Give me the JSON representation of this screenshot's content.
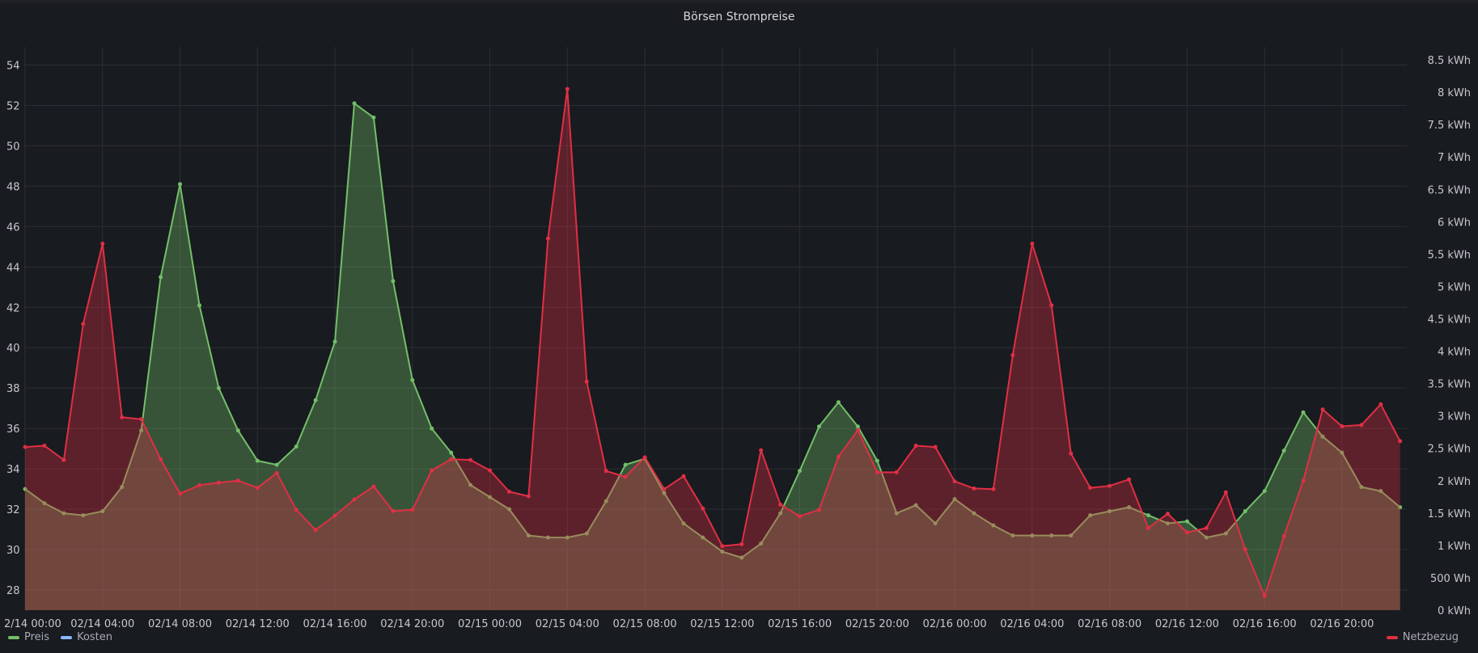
{
  "panel": {
    "title": "Börsen Strompreise"
  },
  "legend": {
    "left": [
      {
        "label": "Preis",
        "color": "#73bf69"
      },
      {
        "label": "Kosten",
        "color": "#8ab8ff"
      }
    ],
    "right": [
      {
        "label": "Netzbezug",
        "color": "#e02f44"
      }
    ]
  },
  "chart_data": {
    "type": "area",
    "title": "Börsen Strompreise",
    "x_ticks": [
      "2/14 00:00",
      "02/14 04:00",
      "02/14 08:00",
      "02/14 12:00",
      "02/14 16:00",
      "02/14 20:00",
      "02/15 00:00",
      "02/15 04:00",
      "02/15 08:00",
      "02/15 12:00",
      "02/15 16:00",
      "02/15 20:00",
      "02/16 00:00",
      "02/16 04:00",
      "02/16 08:00",
      "02/16 12:00",
      "02/16 16:00",
      "02/16 20:00"
    ],
    "y_left": {
      "ticks": [
        28,
        30,
        32,
        34,
        36,
        38,
        40,
        42,
        44,
        46,
        48,
        50,
        52,
        54
      ],
      "range": [
        27.0,
        54.9
      ]
    },
    "y_right": {
      "ticks": [
        "0 kWh",
        "500 Wh",
        "1 kWh",
        "1.5 kWh",
        "2 kWh",
        "2.5 kWh",
        "3 kWh",
        "3.5 kWh",
        "4 kWh",
        "4.5 kWh",
        "5 kWh",
        "5.5 kWh",
        "6 kWh",
        "6.5 kWh",
        "7 kWh",
        "7.5 kWh",
        "8 kWh",
        "8.5 kWh"
      ],
      "range_kwh": [
        0,
        8.7
      ]
    },
    "grid": true,
    "series": [
      {
        "name": "Preis",
        "axis": "left",
        "color": "#73bf69",
        "values": [
          33.0,
          32.3,
          31.8,
          31.7,
          31.9,
          33.1,
          35.9,
          43.5,
          48.1,
          42.1,
          38.0,
          35.9,
          34.4,
          34.2,
          35.1,
          37.4,
          40.3,
          52.1,
          51.4,
          43.3,
          38.4,
          36.0,
          34.8,
          33.2,
          32.6,
          32.0,
          30.7,
          30.6,
          30.6,
          30.8,
          32.4,
          34.2,
          34.5,
          32.8,
          31.3,
          30.6,
          29.9,
          29.6,
          30.3,
          31.8,
          33.9,
          36.1,
          37.3,
          36.1,
          34.4,
          31.8,
          32.2,
          31.3,
          32.5,
          31.8,
          31.2,
          30.7,
          30.7,
          30.7,
          30.7,
          31.7,
          31.9,
          32.1,
          31.7,
          31.3,
          31.4,
          30.6,
          30.8,
          31.9,
          32.9,
          34.9,
          36.8,
          35.6,
          34.8,
          33.1,
          32.9,
          32.1
        ]
      },
      {
        "name": "Netzbezug",
        "axis": "right",
        "color": "#e02f44",
        "values_kwh": [
          2.52,
          2.54,
          2.32,
          4.42,
          5.66,
          2.98,
          2.95,
          2.33,
          1.8,
          1.93,
          1.97,
          2.0,
          1.89,
          2.12,
          1.55,
          1.24,
          1.46,
          1.71,
          1.91,
          1.53,
          1.55,
          2.16,
          2.33,
          2.32,
          2.16,
          1.83,
          1.76,
          5.74,
          8.05,
          3.53,
          2.15,
          2.06,
          2.36,
          1.87,
          2.07,
          1.57,
          0.99,
          1.02,
          2.47,
          1.63,
          1.45,
          1.55,
          2.37,
          2.78,
          2.13,
          2.13,
          2.54,
          2.52,
          1.99,
          1.88,
          1.87,
          3.94,
          5.66,
          4.71,
          2.42,
          1.89,
          1.92,
          2.02,
          1.27,
          1.49,
          1.2,
          1.27,
          1.82,
          0.94,
          0.22,
          1.14,
          2.0,
          3.1,
          2.84,
          2.86,
          3.18,
          2.61
        ]
      }
    ]
  }
}
